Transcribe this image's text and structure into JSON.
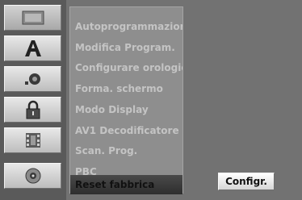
{
  "sidebar": {
    "categories": [
      {
        "icon": "disc-screen-icon"
      },
      {
        "icon": "language-letter-icon"
      },
      {
        "icon": "audio-speaker-icon"
      },
      {
        "icon": "lock-icon"
      },
      {
        "icon": "film-icon"
      },
      {
        "icon": "disc-icon"
      }
    ]
  },
  "menu": {
    "items": [
      {
        "label": "Autoprogrammazione"
      },
      {
        "label": "Modifica Program."
      },
      {
        "label": "Configurare orologio"
      },
      {
        "label": "Forma. schermo"
      },
      {
        "label": "Modo Display"
      },
      {
        "label": "AV1 Decodificatore"
      },
      {
        "label": "Scan. Prog."
      },
      {
        "label": "PBC"
      },
      {
        "label": "Reset fabbrica"
      }
    ],
    "selected_index": 8
  },
  "action_button": {
    "label": "Configr."
  },
  "colors": {
    "background": "#727272",
    "menu": "#8e8e8e",
    "selected": "#3a3a3a"
  }
}
